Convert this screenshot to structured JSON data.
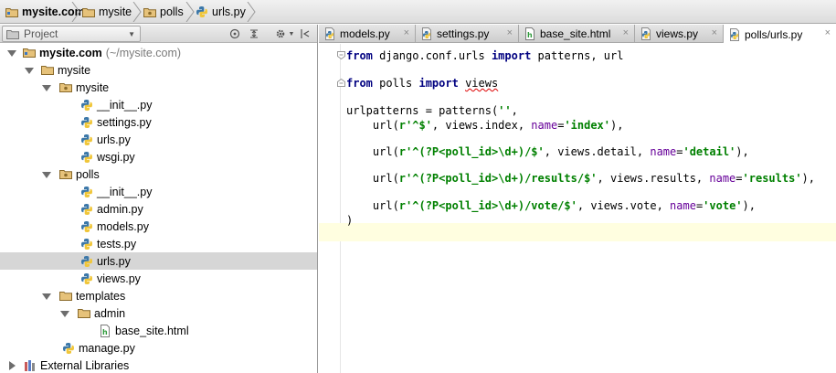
{
  "breadcrumb": {
    "project": "mysite.com",
    "items": [
      "mysite",
      "polls",
      "urls.py"
    ]
  },
  "project_panel": {
    "tab_label": "Project",
    "tree": [
      {
        "label": "mysite.com",
        "path": "(~/mysite.com)",
        "kind": "project-root",
        "bold": true
      },
      {
        "label": "mysite",
        "kind": "folder"
      },
      {
        "label": "mysite",
        "kind": "package"
      },
      {
        "label": "__init__.py",
        "kind": "python-file"
      },
      {
        "label": "settings.py",
        "kind": "python-file"
      },
      {
        "label": "urls.py",
        "kind": "python-file"
      },
      {
        "label": "wsgi.py",
        "kind": "python-file"
      },
      {
        "label": "polls",
        "kind": "package"
      },
      {
        "label": "__init__.py",
        "kind": "python-file"
      },
      {
        "label": "admin.py",
        "kind": "python-file"
      },
      {
        "label": "models.py",
        "kind": "python-file"
      },
      {
        "label": "tests.py",
        "kind": "python-file"
      },
      {
        "label": "urls.py",
        "kind": "python-file",
        "selected": true
      },
      {
        "label": "views.py",
        "kind": "python-file"
      },
      {
        "label": "templates",
        "kind": "folder"
      },
      {
        "label": "admin",
        "kind": "folder"
      },
      {
        "label": "base_site.html",
        "kind": "html-file"
      },
      {
        "label": "manage.py",
        "kind": "python-file"
      },
      {
        "label": "External Libraries",
        "kind": "library"
      }
    ]
  },
  "editor": {
    "tabs": [
      {
        "label": "models.py",
        "icon": "python-file-icon",
        "closable": true
      },
      {
        "label": "settings.py",
        "icon": "python-file-icon",
        "closable": true
      },
      {
        "label": "base_site.html",
        "icon": "html-file-icon",
        "closable": true
      },
      {
        "label": "views.py",
        "icon": "python-file-icon",
        "closable": true
      },
      {
        "label": "polls/urls.py",
        "icon": "python-file-icon",
        "closable": true,
        "active": true
      }
    ],
    "close_glyph": "×"
  },
  "code": {
    "l1": {
      "kw1": "from",
      "t1": " django.conf.urls ",
      "kw2": "import",
      "t2": " patterns, url"
    },
    "l2": {
      "kw1": "from",
      "t1": " polls ",
      "kw2": "import",
      "t2": " ",
      "warn": "views"
    },
    "l3": {
      "t1": "urlpatterns = patterns(",
      "s1": "''",
      "t2": ","
    },
    "l4": {
      "t1": "    url(",
      "s1": "r'^$'",
      "t2": ", views.index, ",
      "k1": "name",
      "t3": "=",
      "s2": "'index'",
      "t4": "),"
    },
    "l5": {
      "t1": "    url(",
      "s1": "r'^(?P<poll_id>\\d+)/$'",
      "t2": ", views.detail, ",
      "k1": "name",
      "t3": "=",
      "s2": "'detail'",
      "t4": "),"
    },
    "l6": {
      "t1": "    url(",
      "s1": "r'^(?P<poll_id>\\d+)/results/$'",
      "t2": ", views.results, ",
      "k1": "name",
      "t3": "=",
      "s2": "'results'",
      "t4": "),"
    },
    "l7": {
      "t1": "    url(",
      "s1": "r'^(?P<poll_id>\\d+)/vote/$'",
      "t2": ", views.vote, ",
      "k1": "name",
      "t3": "=",
      "s2": "'vote'",
      "t4": "),"
    },
    "l8": {
      "t1": ")"
    }
  },
  "colors": {
    "keyword": "#000080",
    "string": "#008000",
    "kwarg": "#660099",
    "selection": "#d6d6d6",
    "caret_line": "#fffee0"
  }
}
